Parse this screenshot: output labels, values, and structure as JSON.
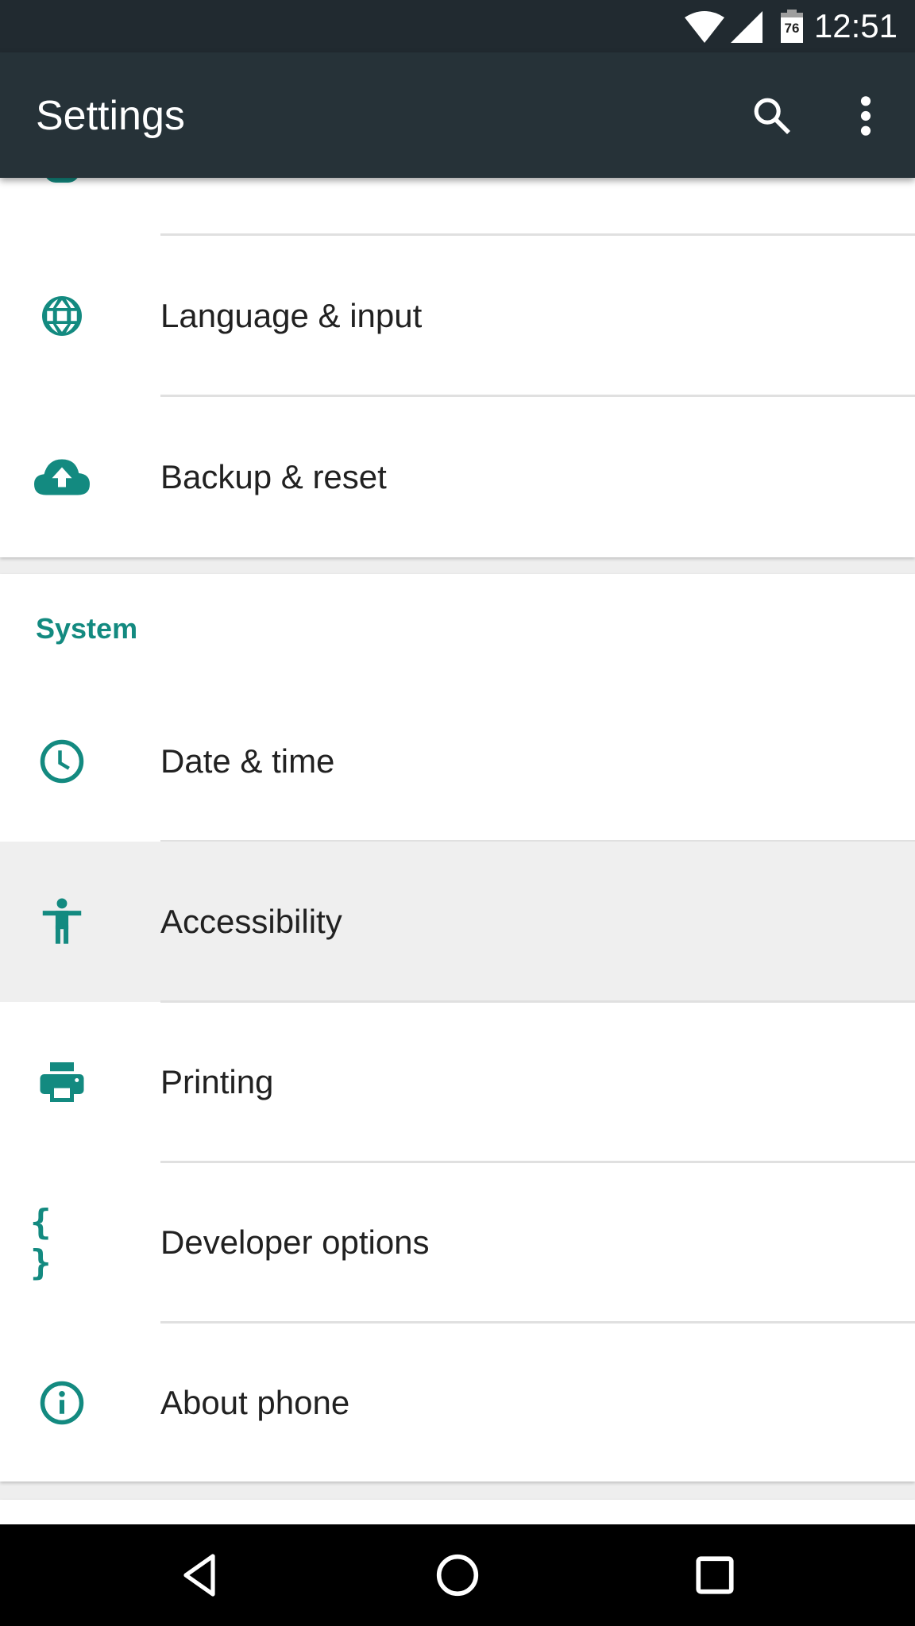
{
  "status_bar": {
    "time": "12:51",
    "battery_level": "76",
    "icons": [
      "wifi-icon",
      "cell-signal-icon",
      "battery-icon"
    ]
  },
  "toolbar": {
    "title": "Settings",
    "search_icon": "search-icon",
    "more_icon": "more-vert-icon"
  },
  "accent_color": "#138a80",
  "top_card": {
    "items": [
      {
        "label": "Language & input",
        "icon": "globe-icon"
      },
      {
        "label": "Backup & reset",
        "icon": "cloud-upload-icon"
      }
    ]
  },
  "system": {
    "header": "System",
    "items": [
      {
        "label": "Date & time",
        "icon": "clock-icon"
      },
      {
        "label": "Accessibility",
        "icon": "accessibility-icon",
        "highlighted": true
      },
      {
        "label": "Printing",
        "icon": "printer-icon"
      },
      {
        "label": "Developer options",
        "icon": "braces-icon"
      },
      {
        "label": "About phone",
        "icon": "info-icon"
      }
    ]
  },
  "nav_bar": {
    "back": "back-icon",
    "home": "home-icon",
    "recents": "recents-icon"
  }
}
